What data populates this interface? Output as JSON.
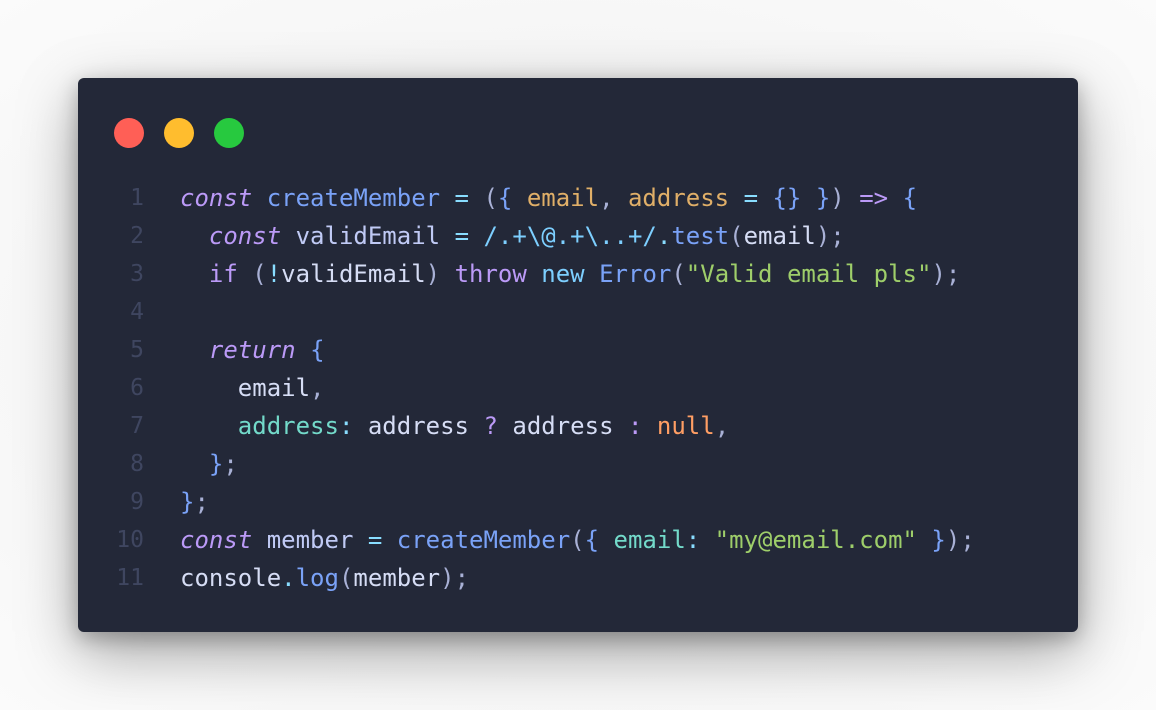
{
  "window_controls": {
    "close_color": "#ff5f56",
    "minimize_color": "#ffbd2e",
    "maximize_color": "#27c93f"
  },
  "code": {
    "line_numbers": [
      "1",
      "2",
      "3",
      "4",
      "5",
      "6",
      "7",
      "8",
      "9",
      "10",
      "11"
    ],
    "lines": [
      [
        {
          "t": "const",
          "c": "k-it"
        },
        {
          "t": " ",
          "c": "var"
        },
        {
          "t": "createMember",
          "c": "fn"
        },
        {
          "t": " ",
          "c": "var"
        },
        {
          "t": "=",
          "c": "op"
        },
        {
          "t": " ",
          "c": "var"
        },
        {
          "t": "(",
          "c": "pn"
        },
        {
          "t": "{",
          "c": "br"
        },
        {
          "t": " ",
          "c": "var"
        },
        {
          "t": "email",
          "c": "prm"
        },
        {
          "t": ",",
          "c": "pn"
        },
        {
          "t": " ",
          "c": "var"
        },
        {
          "t": "address",
          "c": "prm"
        },
        {
          "t": " ",
          "c": "var"
        },
        {
          "t": "=",
          "c": "op"
        },
        {
          "t": " ",
          "c": "var"
        },
        {
          "t": "{}",
          "c": "br"
        },
        {
          "t": " ",
          "c": "var"
        },
        {
          "t": "}",
          "c": "br"
        },
        {
          "t": ")",
          "c": "pn"
        },
        {
          "t": " ",
          "c": "var"
        },
        {
          "t": "=>",
          "c": "k"
        },
        {
          "t": " ",
          "c": "var"
        },
        {
          "t": "{",
          "c": "br"
        }
      ],
      [
        {
          "t": "  ",
          "c": "var"
        },
        {
          "t": "const",
          "c": "k-it"
        },
        {
          "t": " ",
          "c": "var"
        },
        {
          "t": "validEmail",
          "c": "var"
        },
        {
          "t": " ",
          "c": "var"
        },
        {
          "t": "=",
          "c": "op"
        },
        {
          "t": " ",
          "c": "var"
        },
        {
          "t": "/.+\\@.+\\..+/",
          "c": "kw2"
        },
        {
          "t": ".",
          "c": "op"
        },
        {
          "t": "test",
          "c": "fn"
        },
        {
          "t": "(",
          "c": "pn"
        },
        {
          "t": "email",
          "c": "ident"
        },
        {
          "t": ")",
          "c": "pn"
        },
        {
          "t": ";",
          "c": "pn"
        }
      ],
      [
        {
          "t": "  ",
          "c": "var"
        },
        {
          "t": "if",
          "c": "k"
        },
        {
          "t": " ",
          "c": "var"
        },
        {
          "t": "(",
          "c": "pn"
        },
        {
          "t": "!",
          "c": "op"
        },
        {
          "t": "validEmail",
          "c": "ident"
        },
        {
          "t": ")",
          "c": "pn"
        },
        {
          "t": " ",
          "c": "var"
        },
        {
          "t": "throw",
          "c": "k"
        },
        {
          "t": " ",
          "c": "var"
        },
        {
          "t": "new",
          "c": "kw2"
        },
        {
          "t": " ",
          "c": "var"
        },
        {
          "t": "Error",
          "c": "cls"
        },
        {
          "t": "(",
          "c": "pn"
        },
        {
          "t": "\"Valid email pls\"",
          "c": "str"
        },
        {
          "t": ")",
          "c": "pn"
        },
        {
          "t": ";",
          "c": "pn"
        }
      ],
      [],
      [
        {
          "t": "  ",
          "c": "var"
        },
        {
          "t": "return",
          "c": "k-it"
        },
        {
          "t": " ",
          "c": "var"
        },
        {
          "t": "{",
          "c": "br"
        }
      ],
      [
        {
          "t": "    ",
          "c": "var"
        },
        {
          "t": "email",
          "c": "ident"
        },
        {
          "t": ",",
          "c": "pn"
        }
      ],
      [
        {
          "t": "    ",
          "c": "var"
        },
        {
          "t": "address",
          "c": "prop"
        },
        {
          "t": ":",
          "c": "op"
        },
        {
          "t": " ",
          "c": "var"
        },
        {
          "t": "address",
          "c": "ident"
        },
        {
          "t": " ",
          "c": "var"
        },
        {
          "t": "?",
          "c": "k"
        },
        {
          "t": " ",
          "c": "var"
        },
        {
          "t": "address",
          "c": "ident"
        },
        {
          "t": " ",
          "c": "var"
        },
        {
          "t": ":",
          "c": "k"
        },
        {
          "t": " ",
          "c": "var"
        },
        {
          "t": "null",
          "c": "nul"
        },
        {
          "t": ",",
          "c": "pn"
        }
      ],
      [
        {
          "t": "  ",
          "c": "var"
        },
        {
          "t": "}",
          "c": "br"
        },
        {
          "t": ";",
          "c": "pn"
        }
      ],
      [
        {
          "t": "}",
          "c": "br"
        },
        {
          "t": ";",
          "c": "pn"
        }
      ],
      [
        {
          "t": "const",
          "c": "k-it"
        },
        {
          "t": " ",
          "c": "var"
        },
        {
          "t": "member",
          "c": "var"
        },
        {
          "t": " ",
          "c": "var"
        },
        {
          "t": "=",
          "c": "op"
        },
        {
          "t": " ",
          "c": "var"
        },
        {
          "t": "createMember",
          "c": "fn"
        },
        {
          "t": "(",
          "c": "pn"
        },
        {
          "t": "{",
          "c": "br"
        },
        {
          "t": " ",
          "c": "var"
        },
        {
          "t": "email",
          "c": "prop"
        },
        {
          "t": ":",
          "c": "op"
        },
        {
          "t": " ",
          "c": "var"
        },
        {
          "t": "\"my@email.com\"",
          "c": "str"
        },
        {
          "t": " ",
          "c": "var"
        },
        {
          "t": "}",
          "c": "br"
        },
        {
          "t": ")",
          "c": "pn"
        },
        {
          "t": ";",
          "c": "pn"
        }
      ],
      [
        {
          "t": "console",
          "c": "ident"
        },
        {
          "t": ".",
          "c": "op"
        },
        {
          "t": "log",
          "c": "fn"
        },
        {
          "t": "(",
          "c": "pn"
        },
        {
          "t": "member",
          "c": "ident"
        },
        {
          "t": ")",
          "c": "pn"
        },
        {
          "t": ";",
          "c": "pn"
        }
      ]
    ]
  }
}
